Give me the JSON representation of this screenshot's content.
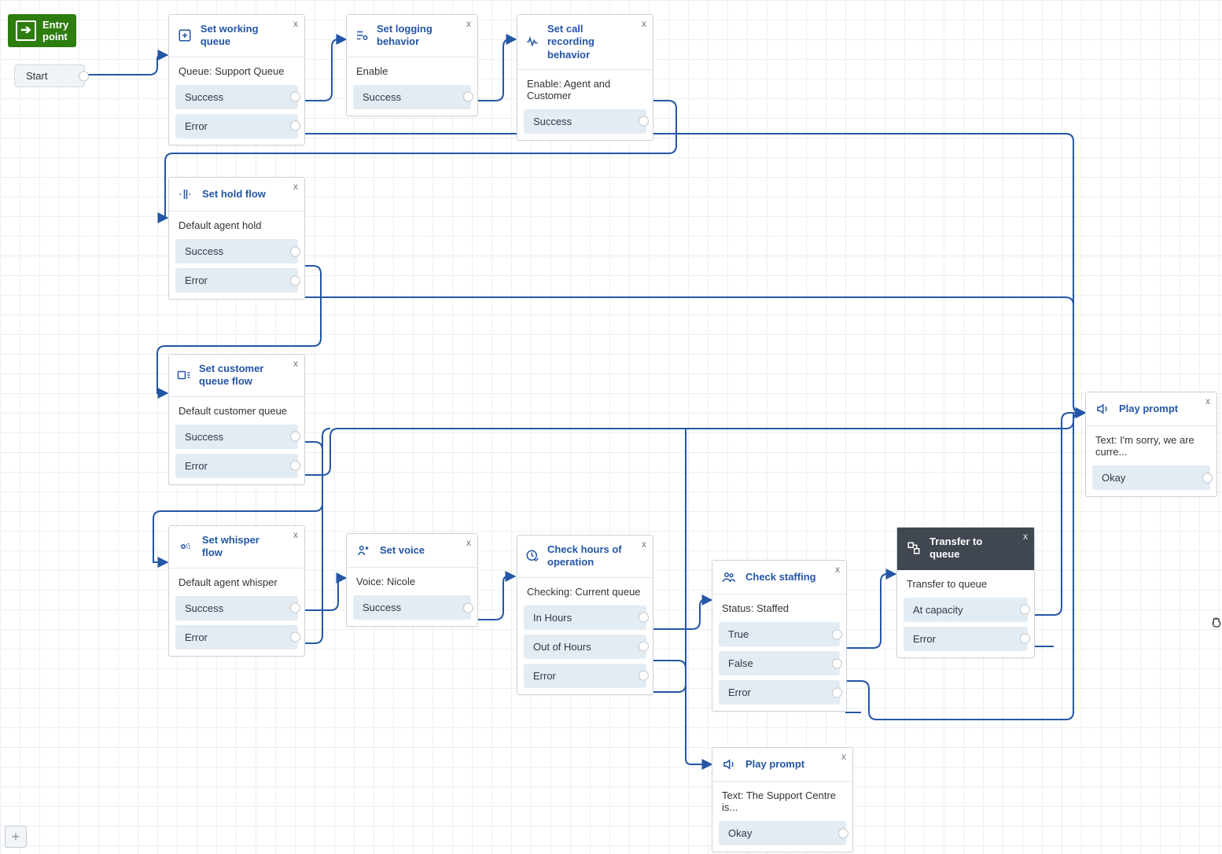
{
  "entry": {
    "label": "Entry\npoint",
    "start_label": "Start"
  },
  "nodes": {
    "set_working_queue": {
      "title": "Set working queue",
      "body": "Queue: Support Queue",
      "branches": {
        "success": "Success",
        "error": "Error"
      }
    },
    "set_logging_behavior": {
      "title": "Set logging behavior",
      "body": "Enable",
      "branches": {
        "success": "Success"
      }
    },
    "set_call_recording_behavior": {
      "title": "Set call recording behavior",
      "body": "Enable: Agent and Customer",
      "branches": {
        "success": "Success"
      }
    },
    "set_hold_flow": {
      "title": "Set hold flow",
      "body": "Default agent hold",
      "branches": {
        "success": "Success",
        "error": "Error"
      }
    },
    "set_customer_queue_flow": {
      "title": "Set customer queue flow",
      "body": "Default customer queue",
      "branches": {
        "success": "Success",
        "error": "Error"
      }
    },
    "set_whisper_flow": {
      "title": "Set whisper flow",
      "body": "Default agent whisper",
      "branches": {
        "success": "Success",
        "error": "Error"
      }
    },
    "set_voice": {
      "title": "Set voice",
      "body": "Voice: Nicole",
      "branches": {
        "success": "Success"
      }
    },
    "check_hours": {
      "title": "Check hours of operation",
      "body": "Checking: Current queue",
      "branches": {
        "in_hours": "In Hours",
        "out_of_hours": "Out of Hours",
        "error": "Error"
      }
    },
    "check_staffing": {
      "title": "Check staffing",
      "body": "Status: Staffed",
      "branches": {
        "true": "True",
        "false": "False",
        "error": "Error"
      }
    },
    "transfer_to_queue": {
      "title": "Transfer to queue",
      "body": "Transfer to queue",
      "branches": {
        "at_capacity": "At capacity",
        "error": "Error"
      }
    },
    "play_prompt_closed": {
      "title": "Play prompt",
      "body": "Text: The Support Centre is...",
      "branches": {
        "okay": "Okay"
      }
    },
    "play_prompt_sorry": {
      "title": "Play prompt",
      "body": "Text: I'm sorry, we are curre...",
      "branches": {
        "okay": "Okay"
      }
    }
  },
  "close_glyph": "x",
  "add_glyph": "+"
}
